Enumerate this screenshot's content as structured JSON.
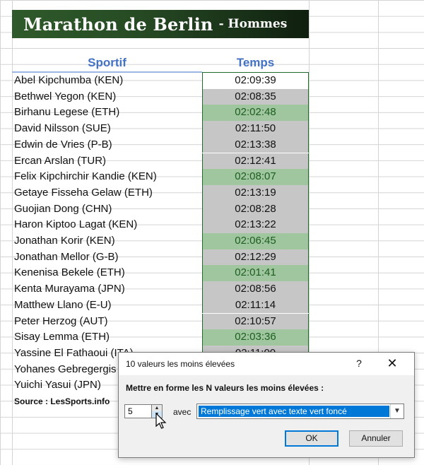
{
  "banner": {
    "title": "Marathon de Berlin",
    "subtitle": "- Hommes"
  },
  "headers": {
    "sportif": "Sportif",
    "temps": "Temps"
  },
  "rows": [
    {
      "name": "Abel Kipchumba (KEN)",
      "time": "02:09:39",
      "style": "white"
    },
    {
      "name": "Bethwel Yegon (KEN)",
      "time": "02:08:35",
      "style": "gray"
    },
    {
      "name": "Birhanu Legese (ETH)",
      "time": "02:02:48",
      "style": "green"
    },
    {
      "name": "David Nilsson (SUE)",
      "time": "02:11:50",
      "style": "gray"
    },
    {
      "name": "Edwin de Vries (P-B)",
      "time": "02:13:38",
      "style": "gray"
    },
    {
      "name": "Ercan Arslan (TUR)",
      "time": "02:12:41",
      "style": "gray"
    },
    {
      "name": "Felix Kipchirchir Kandie (KEN)",
      "time": "02:08:07",
      "style": "green"
    },
    {
      "name": "Getaye Fisseha Gelaw (ETH)",
      "time": "02:13:19",
      "style": "gray"
    },
    {
      "name": "Guojian Dong (CHN)",
      "time": "02:08:28",
      "style": "gray"
    },
    {
      "name": "Haron Kiptoo Lagat (KEN)",
      "time": "02:13:22",
      "style": "gray"
    },
    {
      "name": "Jonathan Korir (KEN)",
      "time": "02:06:45",
      "style": "green"
    },
    {
      "name": "Jonathan Mellor (G-B)",
      "time": "02:12:29",
      "style": "gray"
    },
    {
      "name": "Kenenisa Bekele (ETH)",
      "time": "02:01:41",
      "style": "green"
    },
    {
      "name": "Kenta Murayama (JPN)",
      "time": "02:08:56",
      "style": "gray"
    },
    {
      "name": "Matthew Llano (E-U)",
      "time": "02:11:14",
      "style": "gray"
    },
    {
      "name": "Peter Herzog (AUT)",
      "time": "02:10:57",
      "style": "gray"
    },
    {
      "name": "Sisay Lemma (ETH)",
      "time": "02:03:36",
      "style": "green"
    },
    {
      "name": "Yassine El Fathaoui (ITA)",
      "time": "02:11:00",
      "style": "gray"
    },
    {
      "name": "Yohanes Gebregergis",
      "time": "",
      "style": "gray"
    },
    {
      "name": "Yuichi Yasui (JPN)",
      "time": "",
      "style": "gray"
    }
  ],
  "source": "Source : LesSports.info",
  "dialog": {
    "title": "10 valeurs les moins élevées",
    "help": "?",
    "close": "✕",
    "prompt": "Mettre en forme les N valeurs les moins élevées :",
    "n_value": "5",
    "avec": "avec",
    "format_selected": "Remplissage vert avec texte vert foncé",
    "ok": "OK",
    "cancel": "Annuler"
  },
  "colors": {
    "banner_green": "#274c24",
    "highlight_fill": "#9fc69f",
    "highlight_text": "#1d5d20",
    "gray_fill": "#c6c6c6",
    "header_blue": "#4472c4"
  }
}
